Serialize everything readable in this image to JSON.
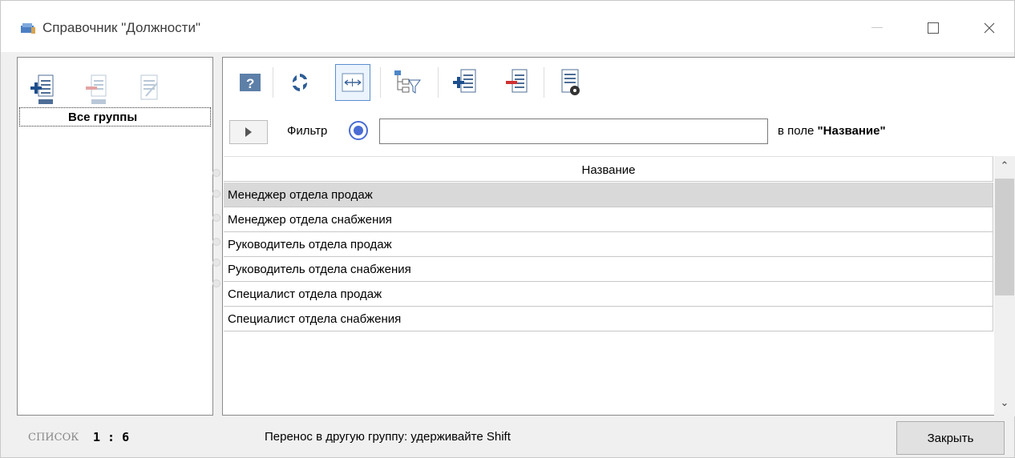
{
  "window": {
    "title": "Справочник \"Должности\"",
    "minimize_icon": "minimize-icon",
    "maximize_icon": "maximize-icon",
    "close_icon": "close-icon"
  },
  "groups": {
    "toolbar": [
      "add-group-icon",
      "delete-group-icon",
      "edit-group-icon"
    ],
    "selected": "Все группы"
  },
  "toolbar": {
    "icons": [
      "help-icon",
      "refresh-icon",
      "fit-columns-icon",
      "tree-filter-icon",
      "add-record-icon",
      "delete-record-icon",
      "settings-icon"
    ]
  },
  "filter": {
    "label": "Фильтр",
    "value": "",
    "field_prefix": "в поле",
    "field_name": "\"Название\""
  },
  "grid": {
    "column": "Название",
    "rows": [
      "Менеджер отдела продаж",
      "Менеджер отдела снабжения",
      "Руководитель отдела продаж",
      "Руководитель отдела снабжения",
      "Специалист отдела продаж",
      "Специалист отдела снабжения"
    ],
    "selected_row": 0
  },
  "status": {
    "label": "СПИСОК",
    "count": "1 : 6",
    "hint": "Перенос в другую группу: удерживайте Shift"
  },
  "buttons": {
    "close": "Закрыть"
  },
  "colors": {
    "accent": "#4a6cd4",
    "selected_row": "#d9d9d9"
  }
}
